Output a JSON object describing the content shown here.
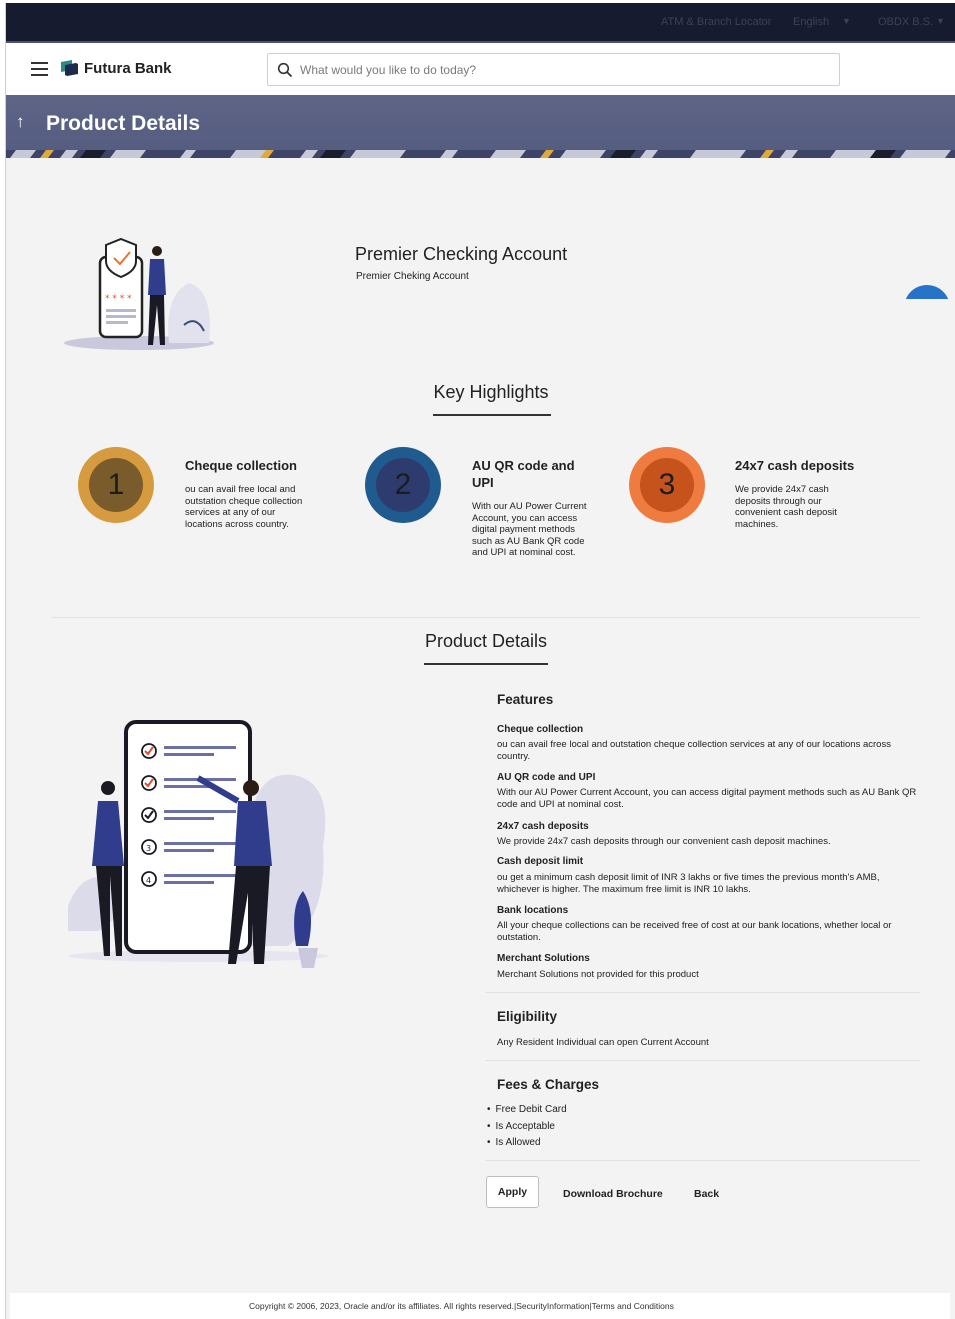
{
  "topbar": {
    "location_label": "ATM & Branch Locator",
    "language": "English",
    "user": "OBDX B.S."
  },
  "header": {
    "brand": "Futura Bank",
    "search_placeholder": "What would you like to do today?"
  },
  "title_band": {
    "title": "Product Details"
  },
  "product": {
    "name": "Premier Checking Account",
    "description": "Premier Cheking Account"
  },
  "key_highlights": {
    "title": "Key Highlights",
    "items": [
      {
        "number": "1",
        "title": "Cheque collection",
        "text": "ou can avail free local and outstation cheque collection services at any of our locations across country.",
        "outer": "#d69a3f",
        "inner": "#7a5b2b"
      },
      {
        "number": "2",
        "title": "AU QR code and UPI",
        "text": "With our AU Power Current Account, you can access digital payment methods such as AU Bank QR code and UPI at nominal cost.",
        "outer": "#1f5b8f",
        "inner": "#2e3b6e"
      },
      {
        "number": "3",
        "title": "24x7 cash deposits",
        "text": "We provide 24x7 cash deposits through our convenient cash deposit machines.",
        "outer": "#f07b41",
        "inner": "#c6521c"
      }
    ]
  },
  "product_details": {
    "title": "Product Details",
    "features_heading": "Features",
    "features": [
      {
        "title": "Cheque collection",
        "text": "ou can avail free local and outstation cheque collection services at any of our locations across country."
      },
      {
        "title": "AU QR code and UPI",
        "text": "With our AU Power Current Account, you can access digital payment methods such as AU Bank QR code and UPI at nominal cost."
      },
      {
        "title": "24x7 cash deposits",
        "text": "We provide 24x7 cash deposits through our convenient cash deposit machines."
      },
      {
        "title": "Cash deposit limit",
        "text": "ou get a minimum cash deposit limit of INR 3 lakhs or five times the previous month's AMB, whichever is higher. The maximum free limit is INR 10 lakhs."
      },
      {
        "title": "Bank locations",
        "text": "All your cheque collections can be received free of cost at our bank locations, whether local or outstation."
      },
      {
        "title": "Merchant Solutions",
        "text": "Merchant Solutions not provided for this product"
      }
    ],
    "eligibility_heading": "Eligibility",
    "eligibility_text": "Any Resident Individual can open Current Account",
    "fees_heading": "Fees & Charges",
    "fees": [
      "Free Debit Card",
      "Is Acceptable",
      "Is Allowed"
    ]
  },
  "actions": {
    "apply": "Apply",
    "download": "Download Brochure",
    "back": "Back"
  },
  "footer": {
    "text": "Copyright © 2006, 2023, Oracle and/or its affiliates. All rights reserved.|SecurityInformation|Terms and Conditions"
  },
  "colors": {
    "topbar": "#161b2f",
    "title_band": "#5a6185",
    "accent_blue": "#2773c9"
  }
}
